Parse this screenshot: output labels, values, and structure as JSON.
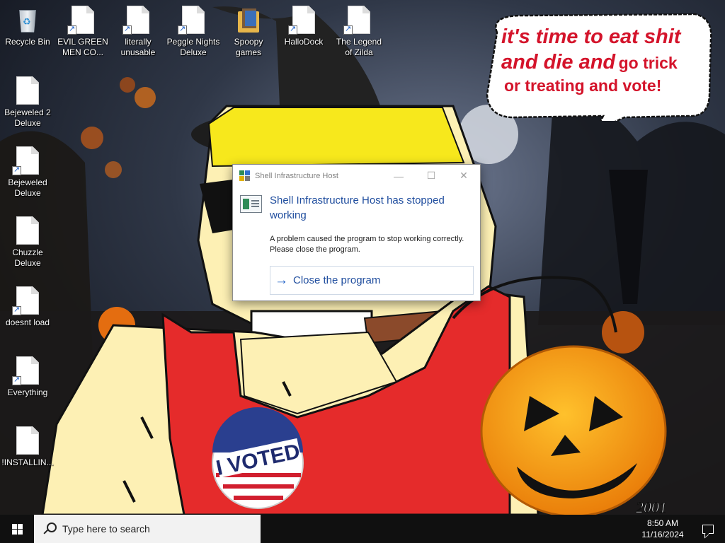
{
  "desktop": {
    "icons": [
      {
        "label": "Recycle Bin",
        "icon": "recycle-bin-icon"
      },
      {
        "label": "EVIL GREEN MEN CO...",
        "icon": "file-shortcut-icon"
      },
      {
        "label": "literally unusable",
        "icon": "file-shortcut-icon"
      },
      {
        "label": "Peggle Nights Deluxe",
        "icon": "file-shortcut-icon"
      },
      {
        "label": "Spoopy games",
        "icon": "folder-icon"
      },
      {
        "label": "HalloDock",
        "icon": "file-shortcut-icon"
      },
      {
        "label": "The Legend of Zilda",
        "icon": "file-shortcut-icon"
      },
      {
        "label": "Bejeweled 2 Deluxe",
        "icon": "file-icon"
      },
      {
        "label": "Bejeweled Deluxe",
        "icon": "file-shortcut-icon"
      },
      {
        "label": "Chuzzle Deluxe",
        "icon": "file-icon"
      },
      {
        "label": "doesnt load",
        "icon": "file-shortcut-icon"
      },
      {
        "label": "Everything",
        "icon": "file-shortcut-icon"
      },
      {
        "label": "!INSTALLIN...",
        "icon": "file-icon"
      }
    ]
  },
  "wallpaper": {
    "speech_line1": "it's time to eat shit",
    "speech_line2a": "and die and",
    "speech_line2b": "go trick",
    "speech_line3": "or treating and vote!",
    "badge_text": "I VOTED",
    "signature": "2001"
  },
  "dialog": {
    "title": "Shell Infrastructure Host",
    "heading": "Shell Infrastructure Host has stopped working",
    "message": "A problem caused the program to stop working correctly. Please close the program.",
    "command_label": "Close the program",
    "minimize_glyph": "—",
    "maximize_glyph": "☐",
    "close_glyph": "✕"
  },
  "taskbar": {
    "search_placeholder": "Type here to search",
    "time": "8:50 AM",
    "date": "11/16/2024"
  },
  "colors": {
    "dialog_heading": "#1f4d9e",
    "speech_text": "#d4142b",
    "taskbar": "#101010",
    "shirt": "#e52b2b",
    "skin": "#fdf0b4",
    "pumpkin": "#f59a16"
  }
}
